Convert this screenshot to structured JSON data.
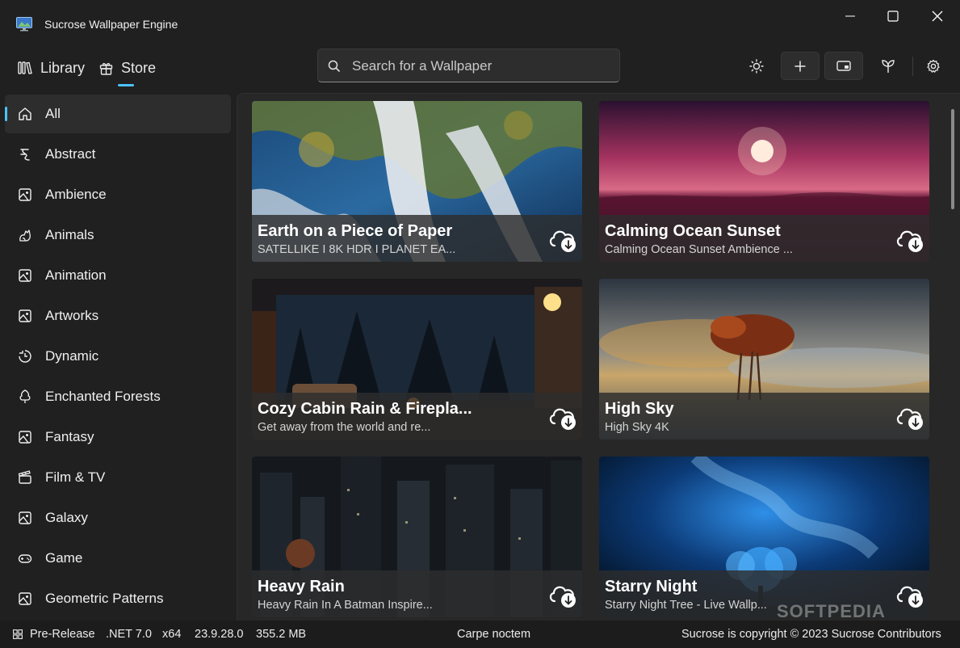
{
  "window": {
    "title": "Sucrose Wallpaper Engine"
  },
  "nav": {
    "library": "Library",
    "store": "Store"
  },
  "search": {
    "placeholder": "Search for a Wallpaper"
  },
  "sidebar": {
    "items": [
      {
        "label": "All",
        "icon": "home-icon"
      },
      {
        "label": "Abstract",
        "icon": "abstract-icon"
      },
      {
        "label": "Ambience",
        "icon": "image-icon"
      },
      {
        "label": "Animals",
        "icon": "animal-icon"
      },
      {
        "label": "Animation",
        "icon": "image-icon"
      },
      {
        "label": "Artworks",
        "icon": "image-icon"
      },
      {
        "label": "Dynamic",
        "icon": "clock-icon"
      },
      {
        "label": "Enchanted Forests",
        "icon": "tree-icon"
      },
      {
        "label": "Fantasy",
        "icon": "image-icon"
      },
      {
        "label": "Film & TV",
        "icon": "clapper-icon"
      },
      {
        "label": "Galaxy",
        "icon": "image-icon"
      },
      {
        "label": "Game",
        "icon": "gamepad-icon"
      },
      {
        "label": "Geometric Patterns",
        "icon": "image-icon"
      }
    ]
  },
  "cards": [
    {
      "title": "Earth on a Piece of Paper",
      "subtitle": "SATELLIKE I 8K HDR I PLANET EA..."
    },
    {
      "title": "Calming Ocean Sunset",
      "subtitle": "Calming Ocean Sunset Ambience ..."
    },
    {
      "title": "Cozy Cabin Rain & Firepla...",
      "subtitle": "Get away from the world and re..."
    },
    {
      "title": "High Sky",
      "subtitle": "High Sky 4K"
    },
    {
      "title": "Heavy Rain",
      "subtitle": "Heavy Rain In A Batman Inspire..."
    },
    {
      "title": "Starry Night",
      "subtitle": "Starry Night Tree - Live Wallp..."
    }
  ],
  "status": {
    "channel": "Pre-Release",
    "framework": ".NET 7.0",
    "arch": "x64",
    "version": "23.9.28.0",
    "memory": "355.2 MB",
    "motto": "Carpe noctem",
    "copyright": "Sucrose is copyright © 2023 Sucrose Contributors"
  },
  "watermark": "SOFTPEDIA",
  "colors": {
    "accent": "#4cc2ff",
    "background": "#202020",
    "panel": "#272727"
  }
}
